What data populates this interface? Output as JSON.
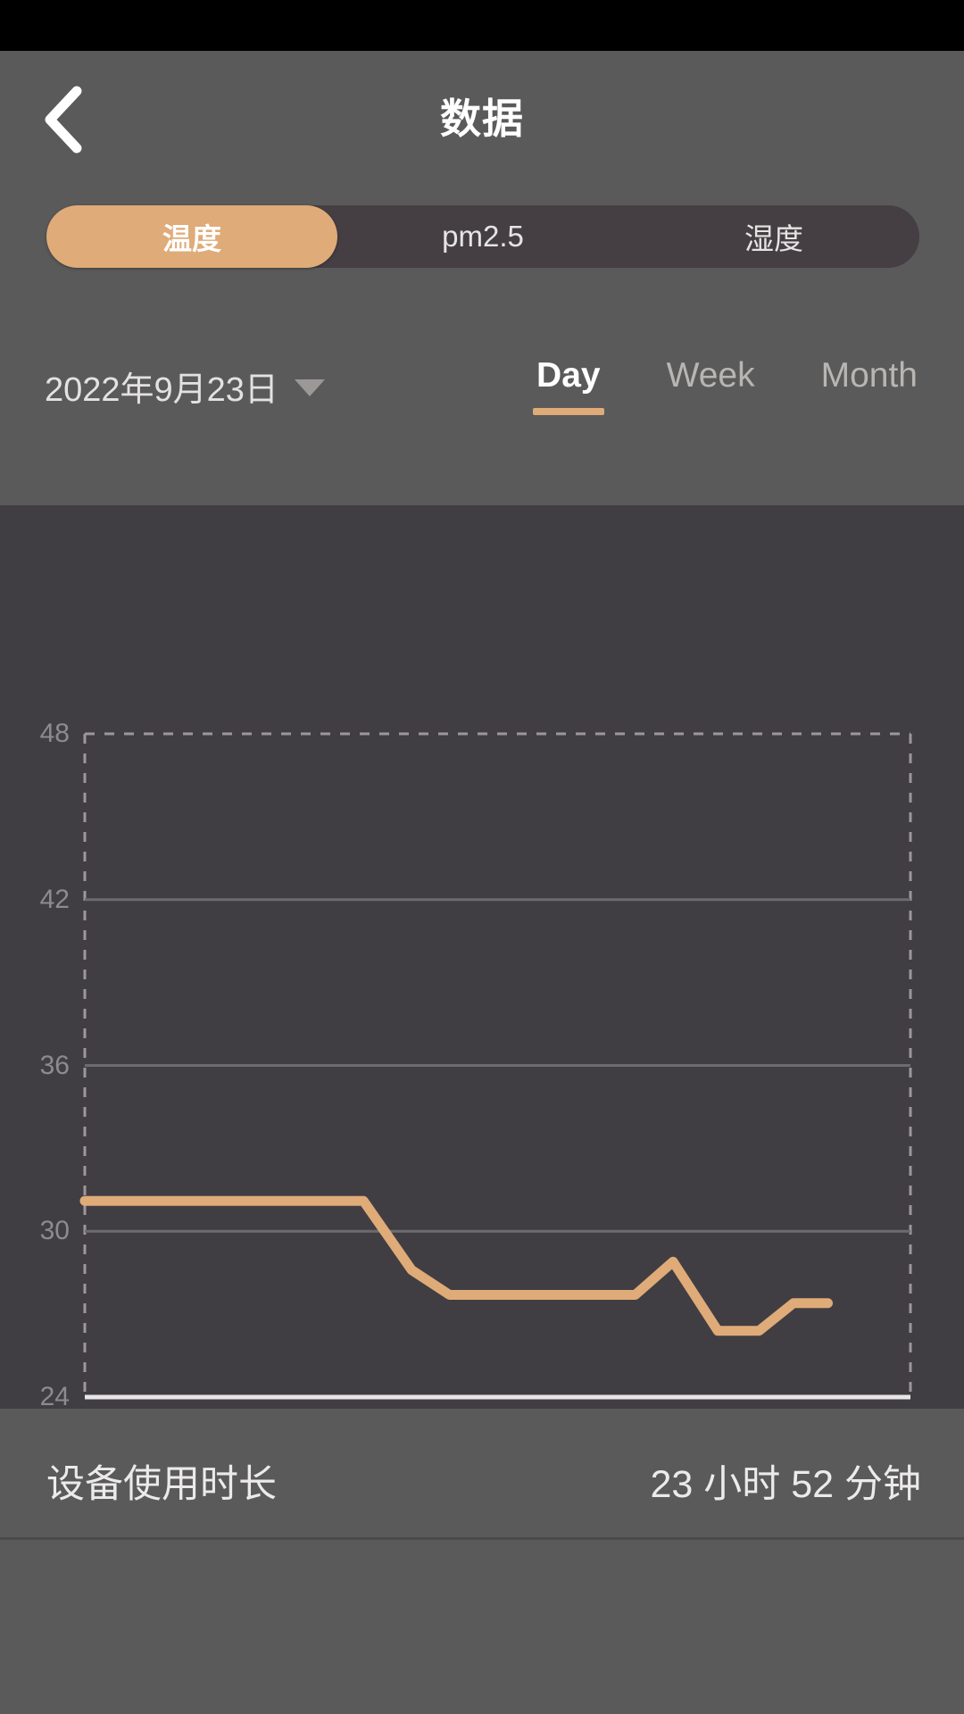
{
  "statusbar": {
    "background": "#000000"
  },
  "appbar": {
    "title": "数据",
    "back_icon": "chevron-left-icon"
  },
  "segments": {
    "items": [
      {
        "label": "温度",
        "active": true
      },
      {
        "label": "pm2.5",
        "active": false
      },
      {
        "label": "湿度",
        "active": false
      }
    ],
    "active_color": "#dfab78",
    "track_color": "#453f44"
  },
  "date_picker": {
    "value": "2022年9月23日",
    "caret_icon": "caret-down-icon"
  },
  "period_tabs": [
    {
      "label": "Day",
      "active": true
    },
    {
      "label": "Week",
      "active": false
    },
    {
      "label": "Month",
      "active": false
    }
  ],
  "footer": {
    "label": "设备使用时长",
    "value": "23 小时 52 分钟"
  },
  "colors": {
    "page_background": "#5a5a5b",
    "chart_background": "#413e43",
    "accent": "#dfab78",
    "gridline": "#6e6b70",
    "axis_dashed": "#9b979c",
    "baseline": "#e8e6e6",
    "tick_text": "#8e8b8e"
  },
  "chart_data": {
    "type": "line",
    "title": "",
    "xlabel": "",
    "ylabel": "",
    "ylim": [
      24,
      48
    ],
    "yticks": [
      48,
      42,
      36,
      30,
      24
    ],
    "grid": true,
    "legend": false,
    "xlim": [
      0,
      24
    ],
    "xticks": [],
    "series": [
      {
        "name": "温度",
        "color": "#dfab78",
        "x": [
          0.0,
          8.1,
          9.5,
          10.6,
          16.0,
          17.1,
          18.4,
          19.6,
          20.6,
          21.6
        ],
        "values": [
          31.1,
          31.1,
          28.6,
          27.7,
          27.7,
          28.9,
          26.4,
          26.4,
          27.4,
          27.4
        ]
      }
    ]
  }
}
